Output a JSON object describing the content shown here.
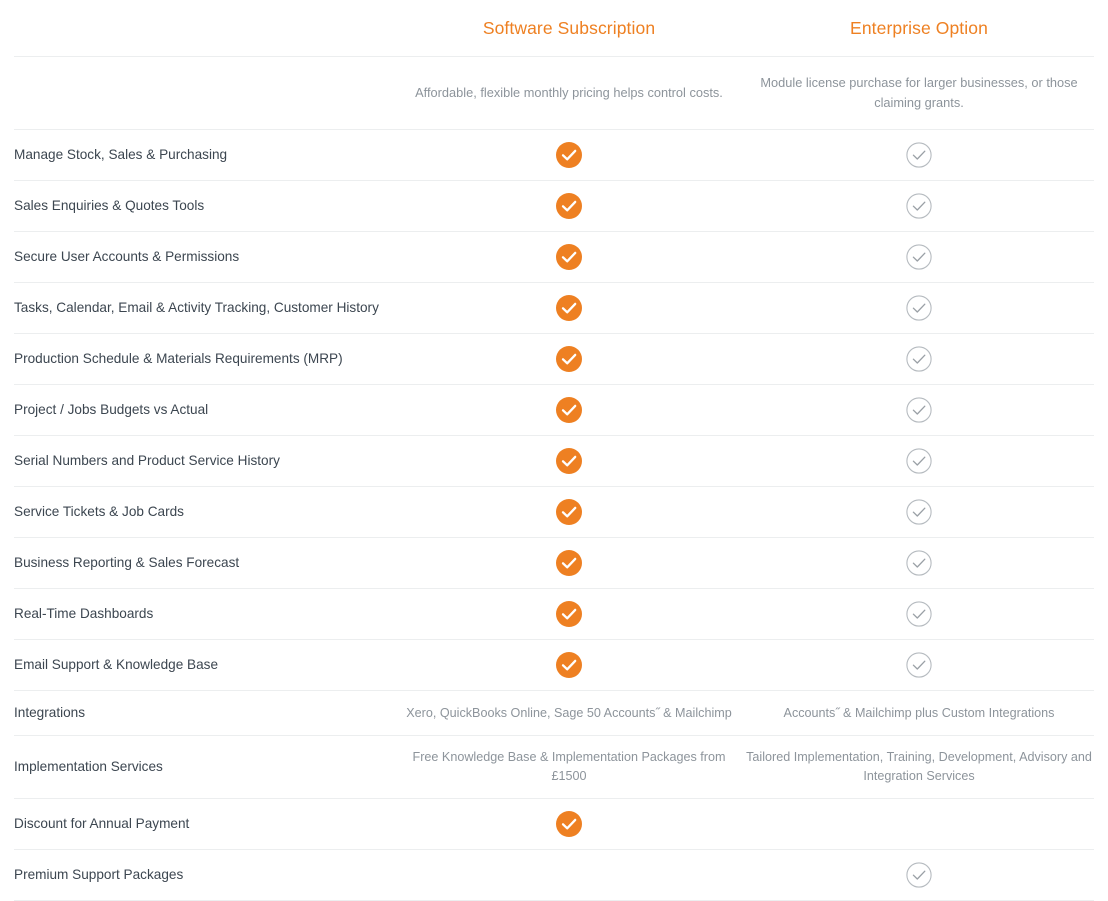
{
  "table": {
    "columns": [
      {
        "key": "feature",
        "label": ""
      },
      {
        "key": "subscription",
        "label": "Software Subscription",
        "tagline": "Affordable, flexible monthly pricing helps control costs."
      },
      {
        "key": "enterprise",
        "label": "Enterprise Option",
        "tagline": "Module license purchase for larger businesses, or those claiming grants."
      }
    ],
    "rows": [
      {
        "feature": "Manage Stock, Sales & Purchasing",
        "subscription": {
          "type": "check-filled"
        },
        "enterprise": {
          "type": "check-outline"
        }
      },
      {
        "feature": "Sales Enquiries & Quotes Tools",
        "subscription": {
          "type": "check-filled"
        },
        "enterprise": {
          "type": "check-outline"
        }
      },
      {
        "feature": "Secure User Accounts & Permissions",
        "subscription": {
          "type": "check-filled"
        },
        "enterprise": {
          "type": "check-outline"
        }
      },
      {
        "feature": "Tasks, Calendar, Email & Activity Tracking, Customer History",
        "subscription": {
          "type": "check-filled"
        },
        "enterprise": {
          "type": "check-outline"
        }
      },
      {
        "feature": "Production Schedule & Materials Requirements (MRP)",
        "subscription": {
          "type": "check-filled"
        },
        "enterprise": {
          "type": "check-outline"
        }
      },
      {
        "feature": "Project / Jobs Budgets vs Actual",
        "subscription": {
          "type": "check-filled"
        },
        "enterprise": {
          "type": "check-outline"
        }
      },
      {
        "feature": "Serial Numbers and Product Service History",
        "subscription": {
          "type": "check-filled"
        },
        "enterprise": {
          "type": "check-outline"
        }
      },
      {
        "feature": "Service Tickets & Job Cards",
        "subscription": {
          "type": "check-filled"
        },
        "enterprise": {
          "type": "check-outline"
        }
      },
      {
        "feature": "Business Reporting & Sales Forecast",
        "subscription": {
          "type": "check-filled"
        },
        "enterprise": {
          "type": "check-outline"
        }
      },
      {
        "feature": "Real-Time Dashboards",
        "subscription": {
          "type": "check-filled"
        },
        "enterprise": {
          "type": "check-outline"
        }
      },
      {
        "feature": "Email Support & Knowledge Base",
        "subscription": {
          "type": "check-filled"
        },
        "enterprise": {
          "type": "check-outline"
        }
      },
      {
        "feature": "Integrations",
        "subscription": {
          "type": "text",
          "text": "Xero, QuickBooks Online, Sage 50 Accounts˝ & Mailchimp"
        },
        "enterprise": {
          "type": "text",
          "text": "Accounts˝ & Mailchimp plus Custom Integrations"
        }
      },
      {
        "feature": "Implementation Services",
        "subscription": {
          "type": "text",
          "text": "Free Knowledge Base & Implementation Packages from £1500"
        },
        "enterprise": {
          "type": "text",
          "text": "Tailored Implementation, Training, Development, Advisory and Integration Services"
        }
      },
      {
        "feature": "Discount for Annual Payment",
        "subscription": {
          "type": "check-filled"
        },
        "enterprise": {
          "type": "empty"
        }
      },
      {
        "feature": "Premium Support Packages",
        "subscription": {
          "type": "empty"
        },
        "enterprise": {
          "type": "check-outline"
        }
      }
    ]
  },
  "icons": {
    "check_filled": {
      "name": "check-filled-icon",
      "fill": "#ee8022",
      "mark": "#ffffff",
      "size": 26
    },
    "check_outline": {
      "name": "check-outline-icon",
      "stroke": "#b6bbc0",
      "mark": "#9aa0a6",
      "size": 26
    }
  },
  "colors": {
    "accent": "#ee8022",
    "text": "#3c4650",
    "muted": "#8d949b",
    "divider": "#eceeef",
    "background": "#ffffff"
  }
}
